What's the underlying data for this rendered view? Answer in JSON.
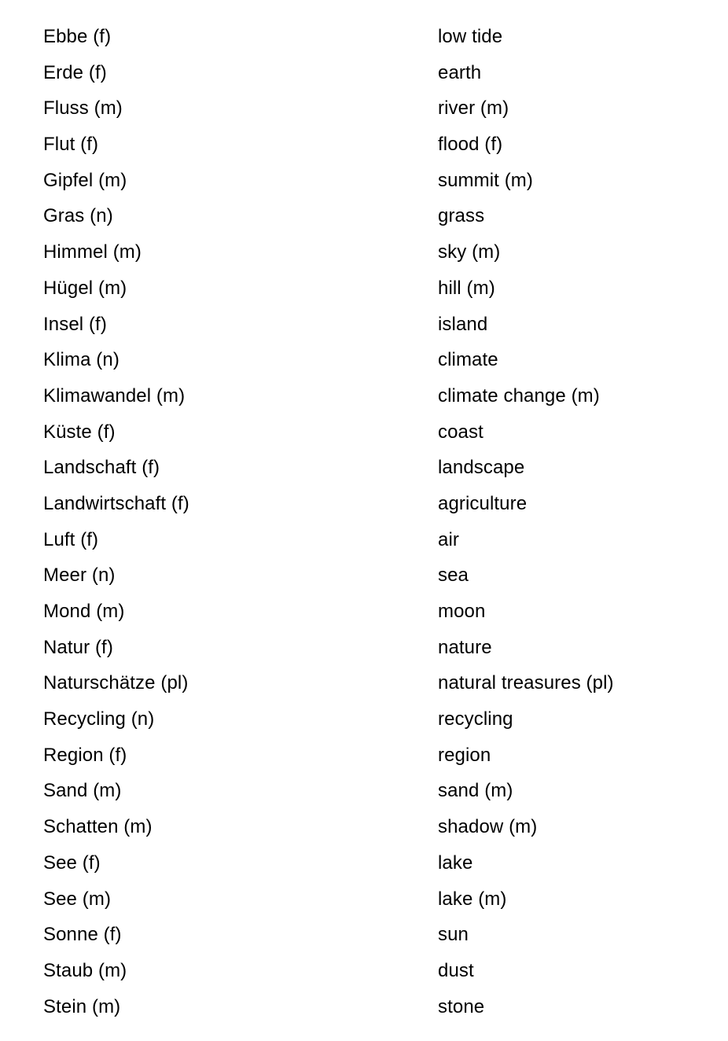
{
  "document": {
    "kind": "vocabulary-list",
    "source_language": "German",
    "target_language": "English",
    "columns": {
      "term": "German term",
      "gloss": "English gloss"
    },
    "row_count": 28,
    "text_color": "#000000",
    "background_color": "#FFFFFF"
  },
  "rows": [
    {
      "term": "Ebbe (f)",
      "gloss": "low tide"
    },
    {
      "term": "Erde (f)",
      "gloss": "earth"
    },
    {
      "term": "Fluss (m)",
      "gloss": "river (m)"
    },
    {
      "term": "Flut (f)",
      "gloss": "flood (f)"
    },
    {
      "term": "Gipfel (m)",
      "gloss": "summit (m)"
    },
    {
      "term": "Gras (n)",
      "gloss": "grass"
    },
    {
      "term": "Himmel (m)",
      "gloss": "sky (m)"
    },
    {
      "term": "Hügel (m)",
      "gloss": "hill (m)"
    },
    {
      "term": "Insel (f)",
      "gloss": "island"
    },
    {
      "term": "Klima (n)",
      "gloss": "climate"
    },
    {
      "term": "Klimawandel (m)",
      "gloss": "climate change (m)"
    },
    {
      "term": "Küste (f)",
      "gloss": "coast"
    },
    {
      "term": "Landschaft (f)",
      "gloss": "landscape"
    },
    {
      "term": "Landwirtschaft (f)",
      "gloss": "agriculture"
    },
    {
      "term": "Luft (f)",
      "gloss": "air"
    },
    {
      "term": "Meer (n)",
      "gloss": "sea"
    },
    {
      "term": "Mond (m)",
      "gloss": "moon"
    },
    {
      "term": "Natur (f)",
      "gloss": "nature"
    },
    {
      "term": "Naturschätze (pl)",
      "gloss": "natural treasures (pl)"
    },
    {
      "term": "Recycling (n)",
      "gloss": "recycling"
    },
    {
      "term": "Region (f)",
      "gloss": "region"
    },
    {
      "term": "Sand (m)",
      "gloss": "sand (m)"
    },
    {
      "term": "Schatten (m)",
      "gloss": "shadow (m)"
    },
    {
      "term": "See (f)",
      "gloss": "lake"
    },
    {
      "term": "See (m)",
      "gloss": "lake (m)"
    },
    {
      "term": "Sonne (f)",
      "gloss": "sun"
    },
    {
      "term": "Staub (m)",
      "gloss": "dust"
    },
    {
      "term": "Stein (m)",
      "gloss": "stone"
    }
  ]
}
